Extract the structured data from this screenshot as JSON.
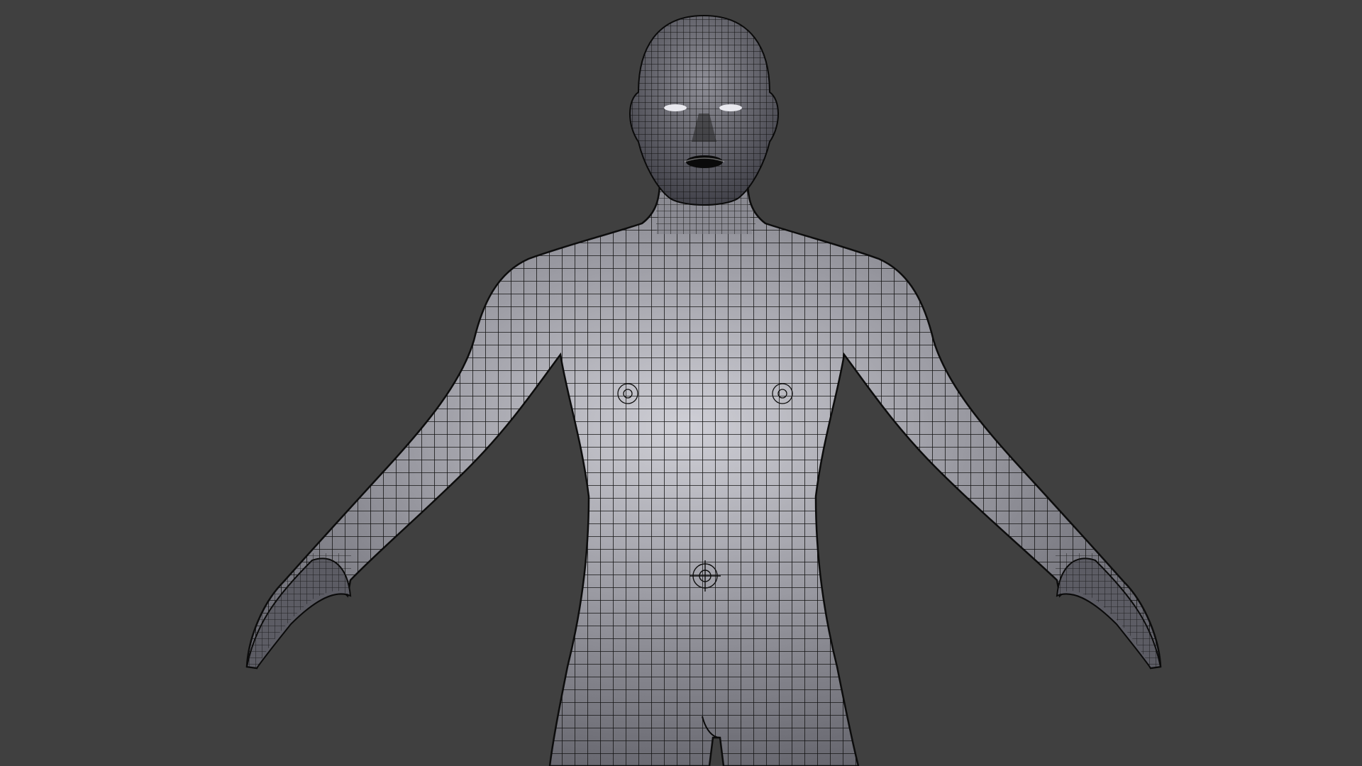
{
  "viewport": {
    "background_color": "#404040",
    "mesh_fill_color": "#9a9aa2",
    "mesh_highlight_color": "#c8c8d0",
    "wire_color": "#111111",
    "subject": "wireframe-human-base-mesh"
  }
}
